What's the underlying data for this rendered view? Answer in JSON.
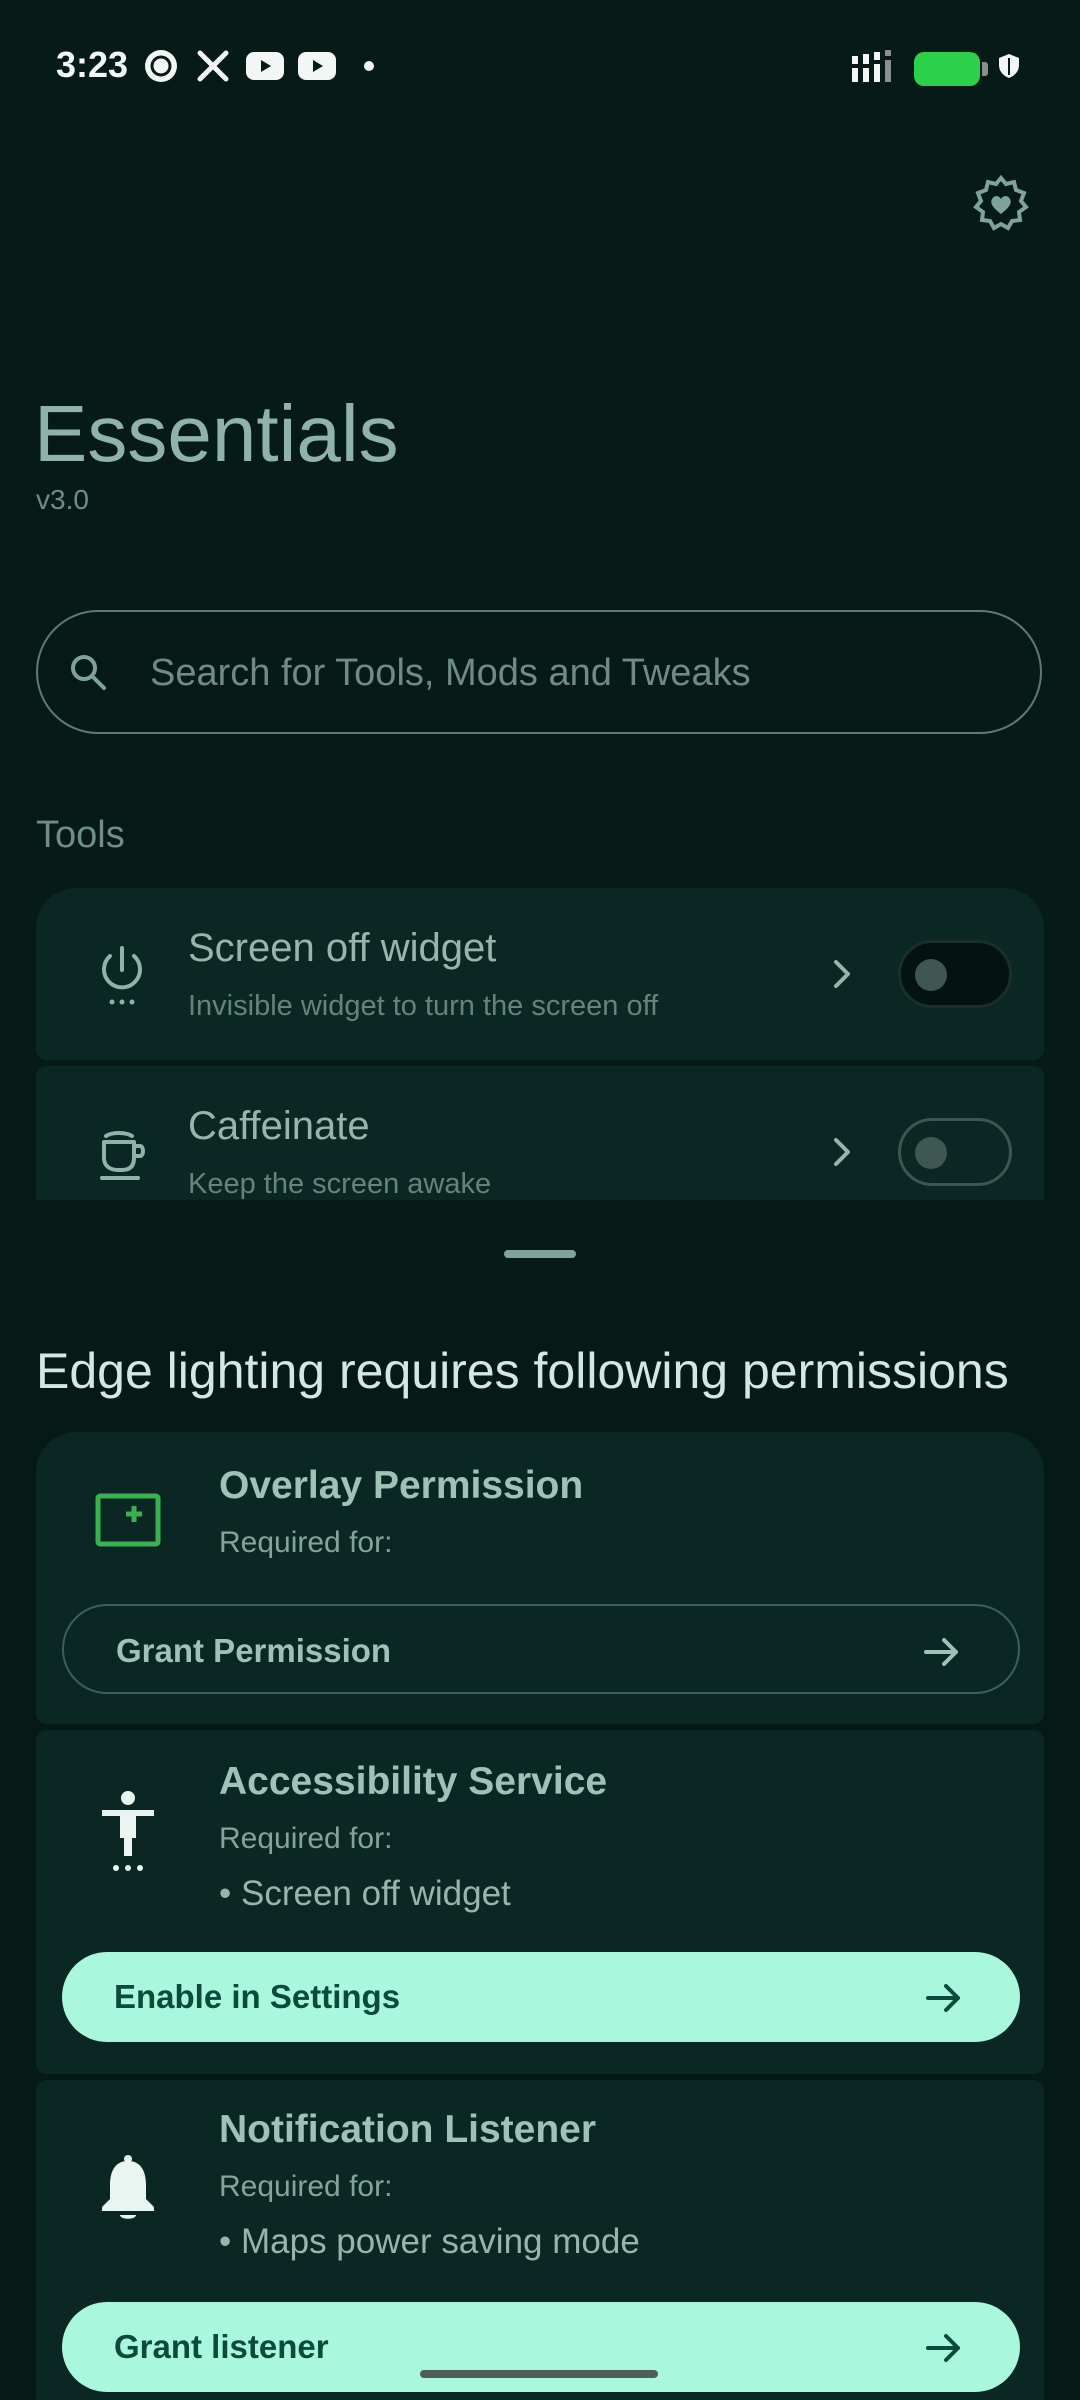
{
  "status_bar": {
    "time": "3:23",
    "left_icons": [
      "news-app-icon",
      "x-icon",
      "youtube-icon",
      "youtube-icon",
      "dot-icon"
    ],
    "right_icons": [
      "signal-icon",
      "battery-icon",
      "shield-icon"
    ],
    "battery_color": "#2bd14b"
  },
  "header": {
    "title": "Essentials",
    "version": "v3.0",
    "settings_icon": "gear-heart-icon"
  },
  "search": {
    "placeholder": "Search for Tools, Mods and Tweaks",
    "value": ""
  },
  "tools": {
    "section_title": "Tools",
    "items": [
      {
        "name": "Screen off widget",
        "description": "Invisible widget to turn the screen off",
        "icon": "power-icon",
        "enabled": false
      },
      {
        "name": "Caffeinate",
        "description": "Keep the screen awake",
        "icon": "coffee-cup-icon",
        "enabled": false
      }
    ]
  },
  "sheet": {
    "title": "Edge lighting requires following permissions",
    "permissions": [
      {
        "title": "Overlay Permission",
        "required_label": "Required for:",
        "items": [],
        "button_label": "Grant Permission",
        "button_style": "outline",
        "icon": "overlay-add-icon"
      },
      {
        "title": "Accessibility Service",
        "required_label": "Required for:",
        "items": [
          "• Screen off widget"
        ],
        "button_label": "Enable in Settings",
        "button_style": "filled",
        "icon": "accessibility-icon"
      },
      {
        "title": "Notification Listener",
        "required_label": "Required for:",
        "items": [
          "• Maps power saving mode"
        ],
        "button_label": "Grant listener",
        "button_style": "filled",
        "icon": "bell-icon"
      }
    ]
  },
  "colors": {
    "background": "#061a17",
    "card": "#0a2723",
    "accent_button": "#a9f7dc",
    "overlay_icon": "#3bb04f"
  }
}
